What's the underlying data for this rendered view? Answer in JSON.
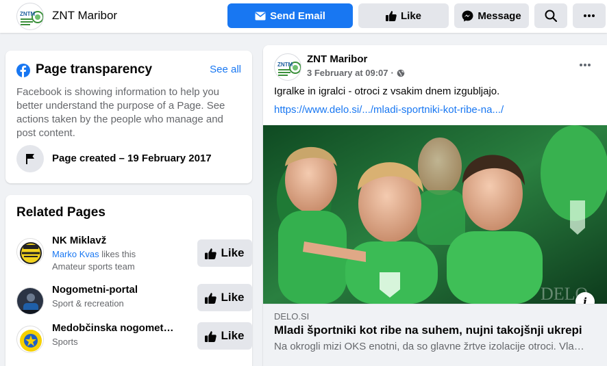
{
  "header": {
    "page_name": "ZNT Maribor",
    "send_email_label": "Send Email",
    "like_label": "Like",
    "message_label": "Message"
  },
  "logo": {
    "text": "ZNTM"
  },
  "transparency": {
    "title": "Page transparency",
    "see_all": "See all",
    "description": "Facebook is showing information to help you better understand the purpose of a Page. See actions taken by the people who manage and post content.",
    "created": "Page created – 19 February 2017"
  },
  "related": {
    "title": "Related Pages",
    "items": [
      {
        "name": "NK Miklavž",
        "sub_link": "Marko Kvas",
        "sub_text": " likes this",
        "category": "Amateur sports team",
        "like": "Like"
      },
      {
        "name": "Nogometni-portal",
        "category": "Sport & recreation",
        "like": "Like"
      },
      {
        "name": "Medobčinska nogomet…",
        "category": "Sports",
        "like": "Like"
      }
    ]
  },
  "post": {
    "author": "ZNT Maribor",
    "time": "3 February at 09:07",
    "text": "Igralke in igralci - otroci z vsakim dnem  izgubljajo.",
    "link": "https://www.delo.si/.../mladi-sportniki-kot-ribe-na.../",
    "image_watermark": "DELO",
    "preview": {
      "domain": "DELO.SI",
      "title": "Mladi športniki kot ribe na suhem, nujni takojšnji ukrepi",
      "description": "Na okrogli mizi OKS enotni, da so glavne žrtve izolacije otroci. Vla…"
    }
  },
  "colors": {
    "brand": "#1877f2",
    "button_grey": "#e4e6eb",
    "background": "#f0f2f5",
    "secondary_text": "#65676b",
    "shirt_green": "#2f9e44"
  }
}
